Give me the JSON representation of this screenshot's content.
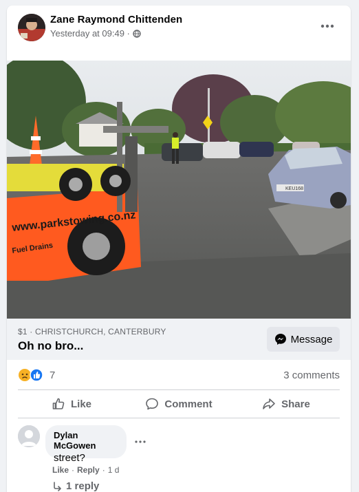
{
  "post": {
    "author": "Zane Raymond Chittenden",
    "timestamp": "Yesterday at 09:49 ·",
    "privacy_icon": "globe-icon",
    "more_icon": "more-horizontal-icon"
  },
  "photo": {
    "sign_text": "www.parkstowing.co.nz",
    "side_text": "Fuel Drains",
    "plate_text": "KEU168"
  },
  "listing": {
    "price_location": "$1 · CHRISTCHURCH, CANTERBURY",
    "title": "Oh no bro...",
    "message_label": "Message"
  },
  "reactions": {
    "count": "7",
    "icons": [
      "sad-reaction-icon",
      "like-reaction-icon"
    ],
    "comments": "3 comments"
  },
  "actions": {
    "like": "Like",
    "comment": "Comment",
    "share": "Share"
  },
  "comment": {
    "author": "Dylan McGowen",
    "text": "street?",
    "like": "Like",
    "reply": "Reply",
    "age": "1 d",
    "replies": "1 reply"
  },
  "colors": {
    "accent": "#1877f2",
    "secondary_text": "#65676b",
    "surface": "#f0f2f5",
    "truck_orange": "#ff5a1f",
    "sad_reaction": "#f7b125"
  }
}
